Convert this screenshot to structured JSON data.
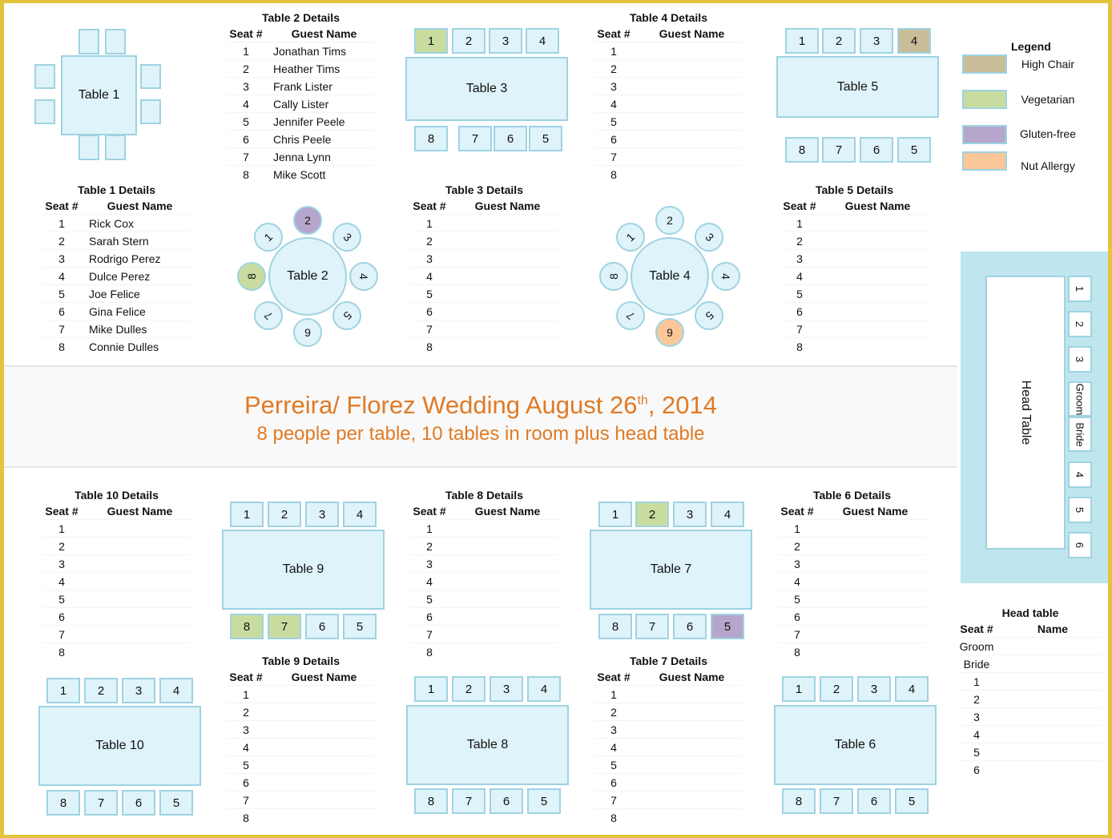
{
  "title": {
    "main": "Perreira/ Florez Wedding August 26",
    "main_sup": "th",
    "main_tail": ", 2014",
    "subtitle": "8 people per table, 10 tables in room plus head table"
  },
  "colors": {
    "accent_title": "#e07a25",
    "table_fill": "#dff3fa",
    "table_border": "#9ed3e2",
    "high_chair": "#c8bd98",
    "vegetarian": "#c9dca0",
    "gluten_free": "#b7a6cc",
    "nut_allergy": "#fcc798",
    "frame": "#e2c53a"
  },
  "legend": {
    "title": "Legend",
    "items": [
      {
        "label": "High Chair",
        "key": "high_chair"
      },
      {
        "label": "Vegetarian",
        "key": "vegetarian"
      },
      {
        "label": "Gluten-free",
        "key": "gluten_free"
      },
      {
        "label": "Nut Allergy",
        "key": "nut_allergy"
      }
    ]
  },
  "tables": {
    "t1": {
      "label": "Table 1"
    },
    "t2": {
      "label": "Table 2",
      "seats": [
        "1",
        "2",
        "3",
        "4",
        "5",
        "9",
        "7",
        "8"
      ]
    },
    "t3": {
      "label": "Table 3",
      "top": [
        "1",
        "2",
        "3",
        "4"
      ],
      "bottom": [
        "8",
        "7",
        "6",
        "5"
      ]
    },
    "t4": {
      "label": "Table 4",
      "seats": [
        "1",
        "2",
        "3",
        "4",
        "5",
        "9",
        "7",
        "8"
      ]
    },
    "t5": {
      "label": "Table 5",
      "top": [
        "1",
        "2",
        "3",
        "4"
      ],
      "bottom": [
        "8",
        "7",
        "6",
        "5"
      ]
    },
    "t6": {
      "label": "Table 6",
      "top": [
        "1",
        "2",
        "3",
        "4"
      ],
      "bottom": [
        "8",
        "7",
        "6",
        "5"
      ]
    },
    "t7": {
      "label": "Table 7",
      "top": [
        "1",
        "2",
        "3",
        "4"
      ],
      "bottom": [
        "8",
        "7",
        "6",
        "5"
      ]
    },
    "t8": {
      "label": "Table 8",
      "top": [
        "1",
        "2",
        "3",
        "4"
      ],
      "bottom": [
        "8",
        "7",
        "6",
        "5"
      ]
    },
    "t9": {
      "label": "Table 9",
      "top": [
        "1",
        "2",
        "3",
        "4"
      ],
      "bottom": [
        "8",
        "7",
        "6",
        "5"
      ]
    },
    "t10": {
      "label": "Table 10",
      "top": [
        "1",
        "2",
        "3",
        "4"
      ],
      "bottom": [
        "8",
        "7",
        "6",
        "5"
      ]
    },
    "head": {
      "label": "Head Table",
      "seats": [
        "1",
        "2",
        "3",
        "Groom",
        "Bride",
        "4",
        "5",
        "6"
      ]
    }
  },
  "special_seats": [
    {
      "table": "t2",
      "seat": "2",
      "diet": "gluten_free"
    },
    {
      "table": "t2",
      "seat": "8",
      "diet": "vegetarian"
    },
    {
      "table": "t3",
      "seat": "1",
      "diet": "vegetarian"
    },
    {
      "table": "t4",
      "seat": "9",
      "diet": "nut_allergy"
    },
    {
      "table": "t5",
      "seat": "4",
      "diet": "high_chair"
    },
    {
      "table": "t7",
      "seat": "2",
      "diet": "vegetarian"
    },
    {
      "table": "t7",
      "seat": "5",
      "diet": "gluten_free"
    },
    {
      "table": "t9",
      "seat": "8",
      "diet": "vegetarian"
    },
    {
      "table": "t9",
      "seat": "7",
      "diet": "vegetarian"
    }
  ],
  "details": {
    "seat_header": "Seat #",
    "name_header": "Guest Name",
    "t1": {
      "title": "Table 1 Details",
      "rows": [
        [
          "1",
          "Rick Cox"
        ],
        [
          "2",
          "Sarah Stern"
        ],
        [
          "3",
          "Rodrigo Perez"
        ],
        [
          "4",
          "Dulce Perez"
        ],
        [
          "5",
          "Joe Felice"
        ],
        [
          "6",
          "Gina Felice"
        ],
        [
          "7",
          "Mike Dulles"
        ],
        [
          "8",
          "Connie Dulles"
        ]
      ]
    },
    "t2": {
      "title": "Table 2 Details",
      "rows": [
        [
          "1",
          "Jonathan Tims"
        ],
        [
          "2",
          "Heather Tims"
        ],
        [
          "3",
          "Frank Lister"
        ],
        [
          "4",
          "Cally Lister"
        ],
        [
          "5",
          "Jennifer Peele"
        ],
        [
          "6",
          "Chris Peele"
        ],
        [
          "7",
          "Jenna  Lynn"
        ],
        [
          "8",
          "Mike Scott"
        ]
      ]
    },
    "t3": {
      "title": "Table 3 Details",
      "rows": [
        [
          "1",
          ""
        ],
        [
          "2",
          ""
        ],
        [
          "3",
          ""
        ],
        [
          "4",
          ""
        ],
        [
          "5",
          ""
        ],
        [
          "6",
          ""
        ],
        [
          "7",
          ""
        ],
        [
          "8",
          ""
        ]
      ]
    },
    "t4": {
      "title": "Table 4 Details",
      "rows": [
        [
          "1",
          ""
        ],
        [
          "2",
          ""
        ],
        [
          "3",
          ""
        ],
        [
          "4",
          ""
        ],
        [
          "5",
          ""
        ],
        [
          "6",
          ""
        ],
        [
          "7",
          ""
        ],
        [
          "8",
          ""
        ]
      ]
    },
    "t5": {
      "title": "Table 5 Details",
      "rows": [
        [
          "1",
          ""
        ],
        [
          "2",
          ""
        ],
        [
          "3",
          ""
        ],
        [
          "4",
          ""
        ],
        [
          "5",
          ""
        ],
        [
          "6",
          ""
        ],
        [
          "7",
          ""
        ],
        [
          "8",
          ""
        ]
      ]
    },
    "t6": {
      "title": "Table 6 Details",
      "rows": [
        [
          "1",
          ""
        ],
        [
          "2",
          ""
        ],
        [
          "3",
          ""
        ],
        [
          "4",
          ""
        ],
        [
          "5",
          ""
        ],
        [
          "6",
          ""
        ],
        [
          "7",
          ""
        ],
        [
          "8",
          ""
        ]
      ]
    },
    "t7": {
      "title": "Table 7 Details",
      "rows": [
        [
          "1",
          ""
        ],
        [
          "2",
          ""
        ],
        [
          "3",
          ""
        ],
        [
          "4",
          ""
        ],
        [
          "5",
          ""
        ],
        [
          "6",
          ""
        ],
        [
          "7",
          ""
        ],
        [
          "8",
          ""
        ]
      ]
    },
    "t8": {
      "title": "Table 8 Details",
      "rows": [
        [
          "1",
          ""
        ],
        [
          "2",
          ""
        ],
        [
          "3",
          ""
        ],
        [
          "4",
          ""
        ],
        [
          "5",
          ""
        ],
        [
          "6",
          ""
        ],
        [
          "7",
          ""
        ],
        [
          "8",
          ""
        ]
      ]
    },
    "t9": {
      "title": "Table 9 Details",
      "rows": [
        [
          "1",
          ""
        ],
        [
          "2",
          ""
        ],
        [
          "3",
          ""
        ],
        [
          "4",
          ""
        ],
        [
          "5",
          ""
        ],
        [
          "6",
          ""
        ],
        [
          "7",
          ""
        ],
        [
          "8",
          ""
        ]
      ]
    },
    "t10": {
      "title": "Table 10 Details",
      "rows": [
        [
          "1",
          ""
        ],
        [
          "2",
          ""
        ],
        [
          "3",
          ""
        ],
        [
          "4",
          ""
        ],
        [
          "5",
          ""
        ],
        [
          "6",
          ""
        ],
        [
          "7",
          ""
        ],
        [
          "8",
          ""
        ]
      ]
    },
    "head": {
      "title": "Head table",
      "seat_header": "Seat #",
      "name_header": "Name",
      "rows": [
        [
          "Groom",
          ""
        ],
        [
          "Bride",
          ""
        ],
        [
          "1",
          ""
        ],
        [
          "2",
          ""
        ],
        [
          "3",
          ""
        ],
        [
          "4",
          ""
        ],
        [
          "5",
          ""
        ],
        [
          "6",
          ""
        ]
      ]
    }
  }
}
